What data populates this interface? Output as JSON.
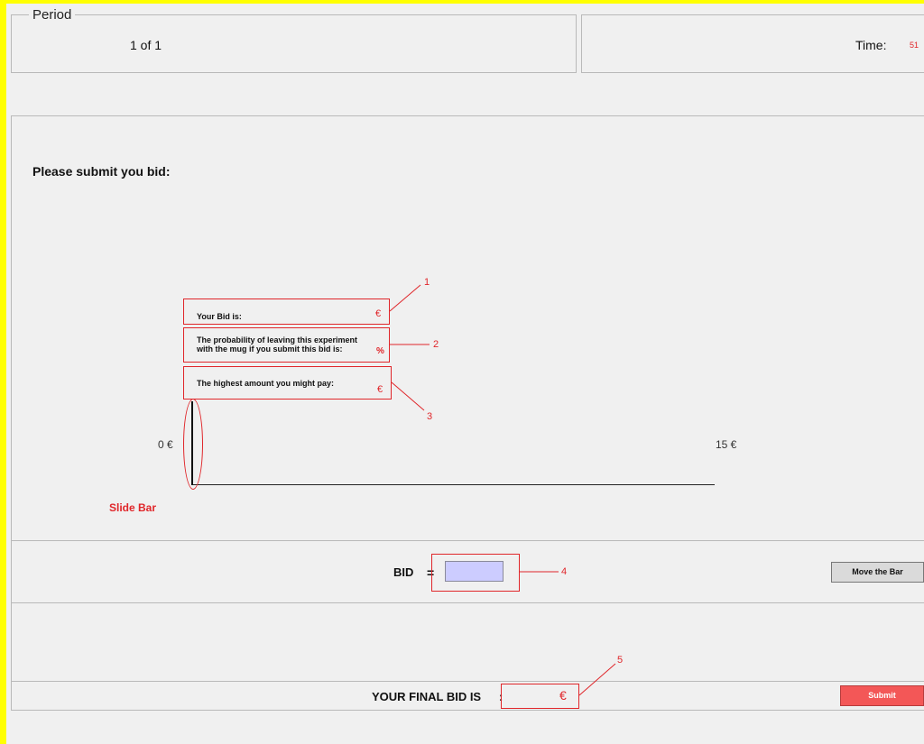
{
  "period": {
    "legend": "Period",
    "value": "1 of 1"
  },
  "timer": {
    "label": "Time:",
    "value": "51"
  },
  "prompt": "Please submit you bid:",
  "info_boxes": [
    {
      "label": "Your Bid is:",
      "unit": "€",
      "marker": "1"
    },
    {
      "label_line1": "The probability of leaving this experiment",
      "label_line2": "with the mug if you submit this bid is:",
      "unit": "%",
      "marker": "2"
    },
    {
      "label": "The highest amount you might pay:",
      "unit": "€",
      "marker": "3"
    }
  ],
  "slider": {
    "min_label": "0 €",
    "max_label": "15 €",
    "annotation": "Slide Bar"
  },
  "bid_row": {
    "label": "BID",
    "equals": "=",
    "input_value": "",
    "marker": "4",
    "move_button": "Move the Bar"
  },
  "final_row": {
    "label": "YOUR FINAL BID IS",
    "colon": ":",
    "unit": "€",
    "marker": "5",
    "submit_button": "Submit"
  },
  "colors": {
    "annotation_red": "#e0262a",
    "input_fill": "#ccccff",
    "submit_fill": "#f35757",
    "highlight_yellow": "#ffff00"
  }
}
